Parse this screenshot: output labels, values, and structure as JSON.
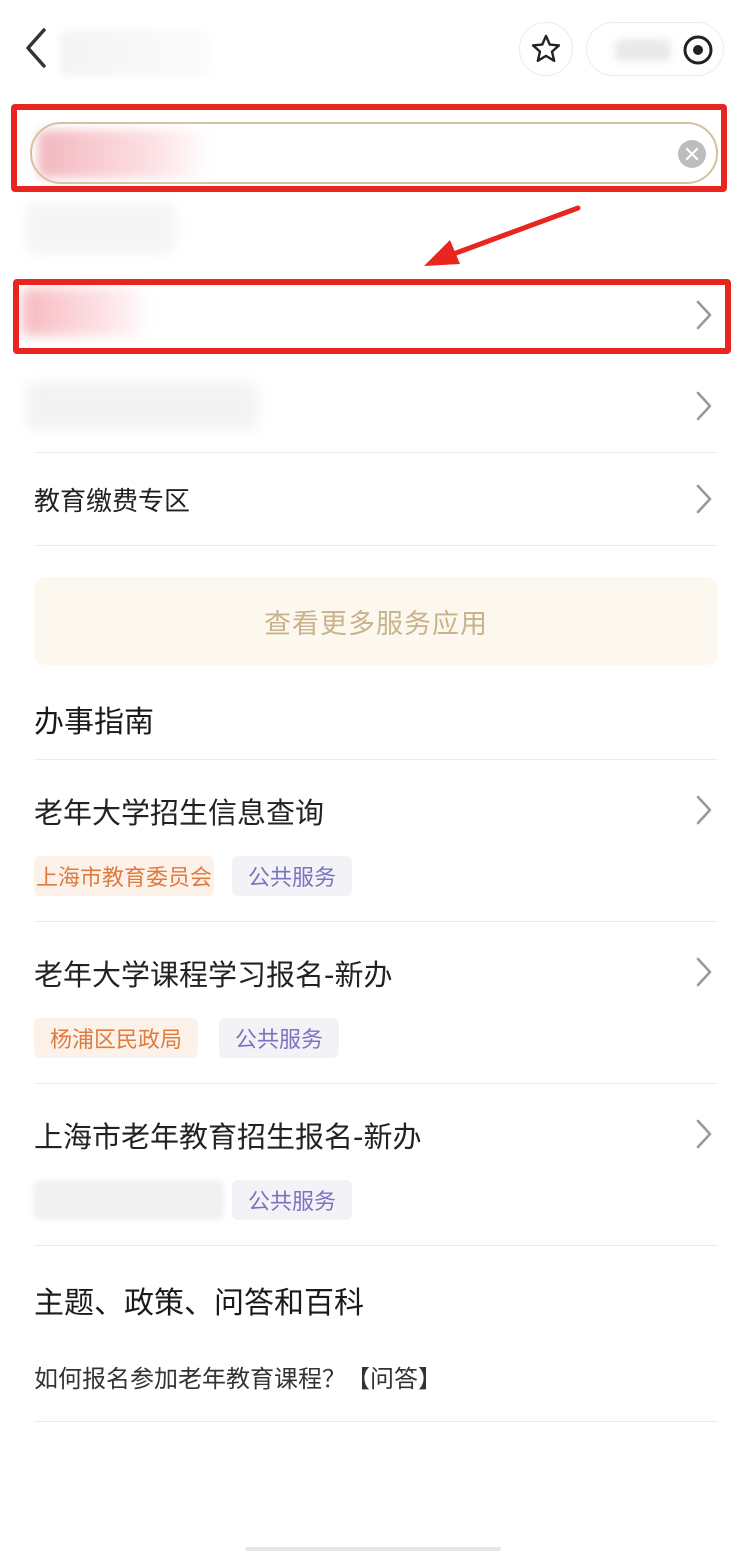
{
  "header": {
    "back_icon": "chevron-left-icon",
    "favorite_icon": "star-icon",
    "capsule_icon": "target-icon"
  },
  "search": {
    "clear_icon": "clear-icon"
  },
  "services": {
    "education_fee_label": "教育缴费专区",
    "more_button": "查看更多服务应用"
  },
  "guide": {
    "section_title": "办事指南",
    "items": [
      {
        "title": "老年大学招生信息查询",
        "org": "上海市教育委员会",
        "type": "公共服务"
      },
      {
        "title": "老年大学课程学习报名-新办",
        "org": "杨浦区民政局",
        "type": "公共服务"
      },
      {
        "title": "上海市老年教育招生报名-新办",
        "org": "",
        "type": "公共服务"
      }
    ]
  },
  "topics": {
    "section_title": "主题、政策、问答和百科",
    "qa_item": "如何报名参加老年教育课程？【问答】"
  },
  "colors": {
    "highlight_red": "#e8261f",
    "accent_gold": "#c8b38a",
    "tag_org_text": "#e07b3f",
    "tag_type_text": "#7a74c0"
  }
}
